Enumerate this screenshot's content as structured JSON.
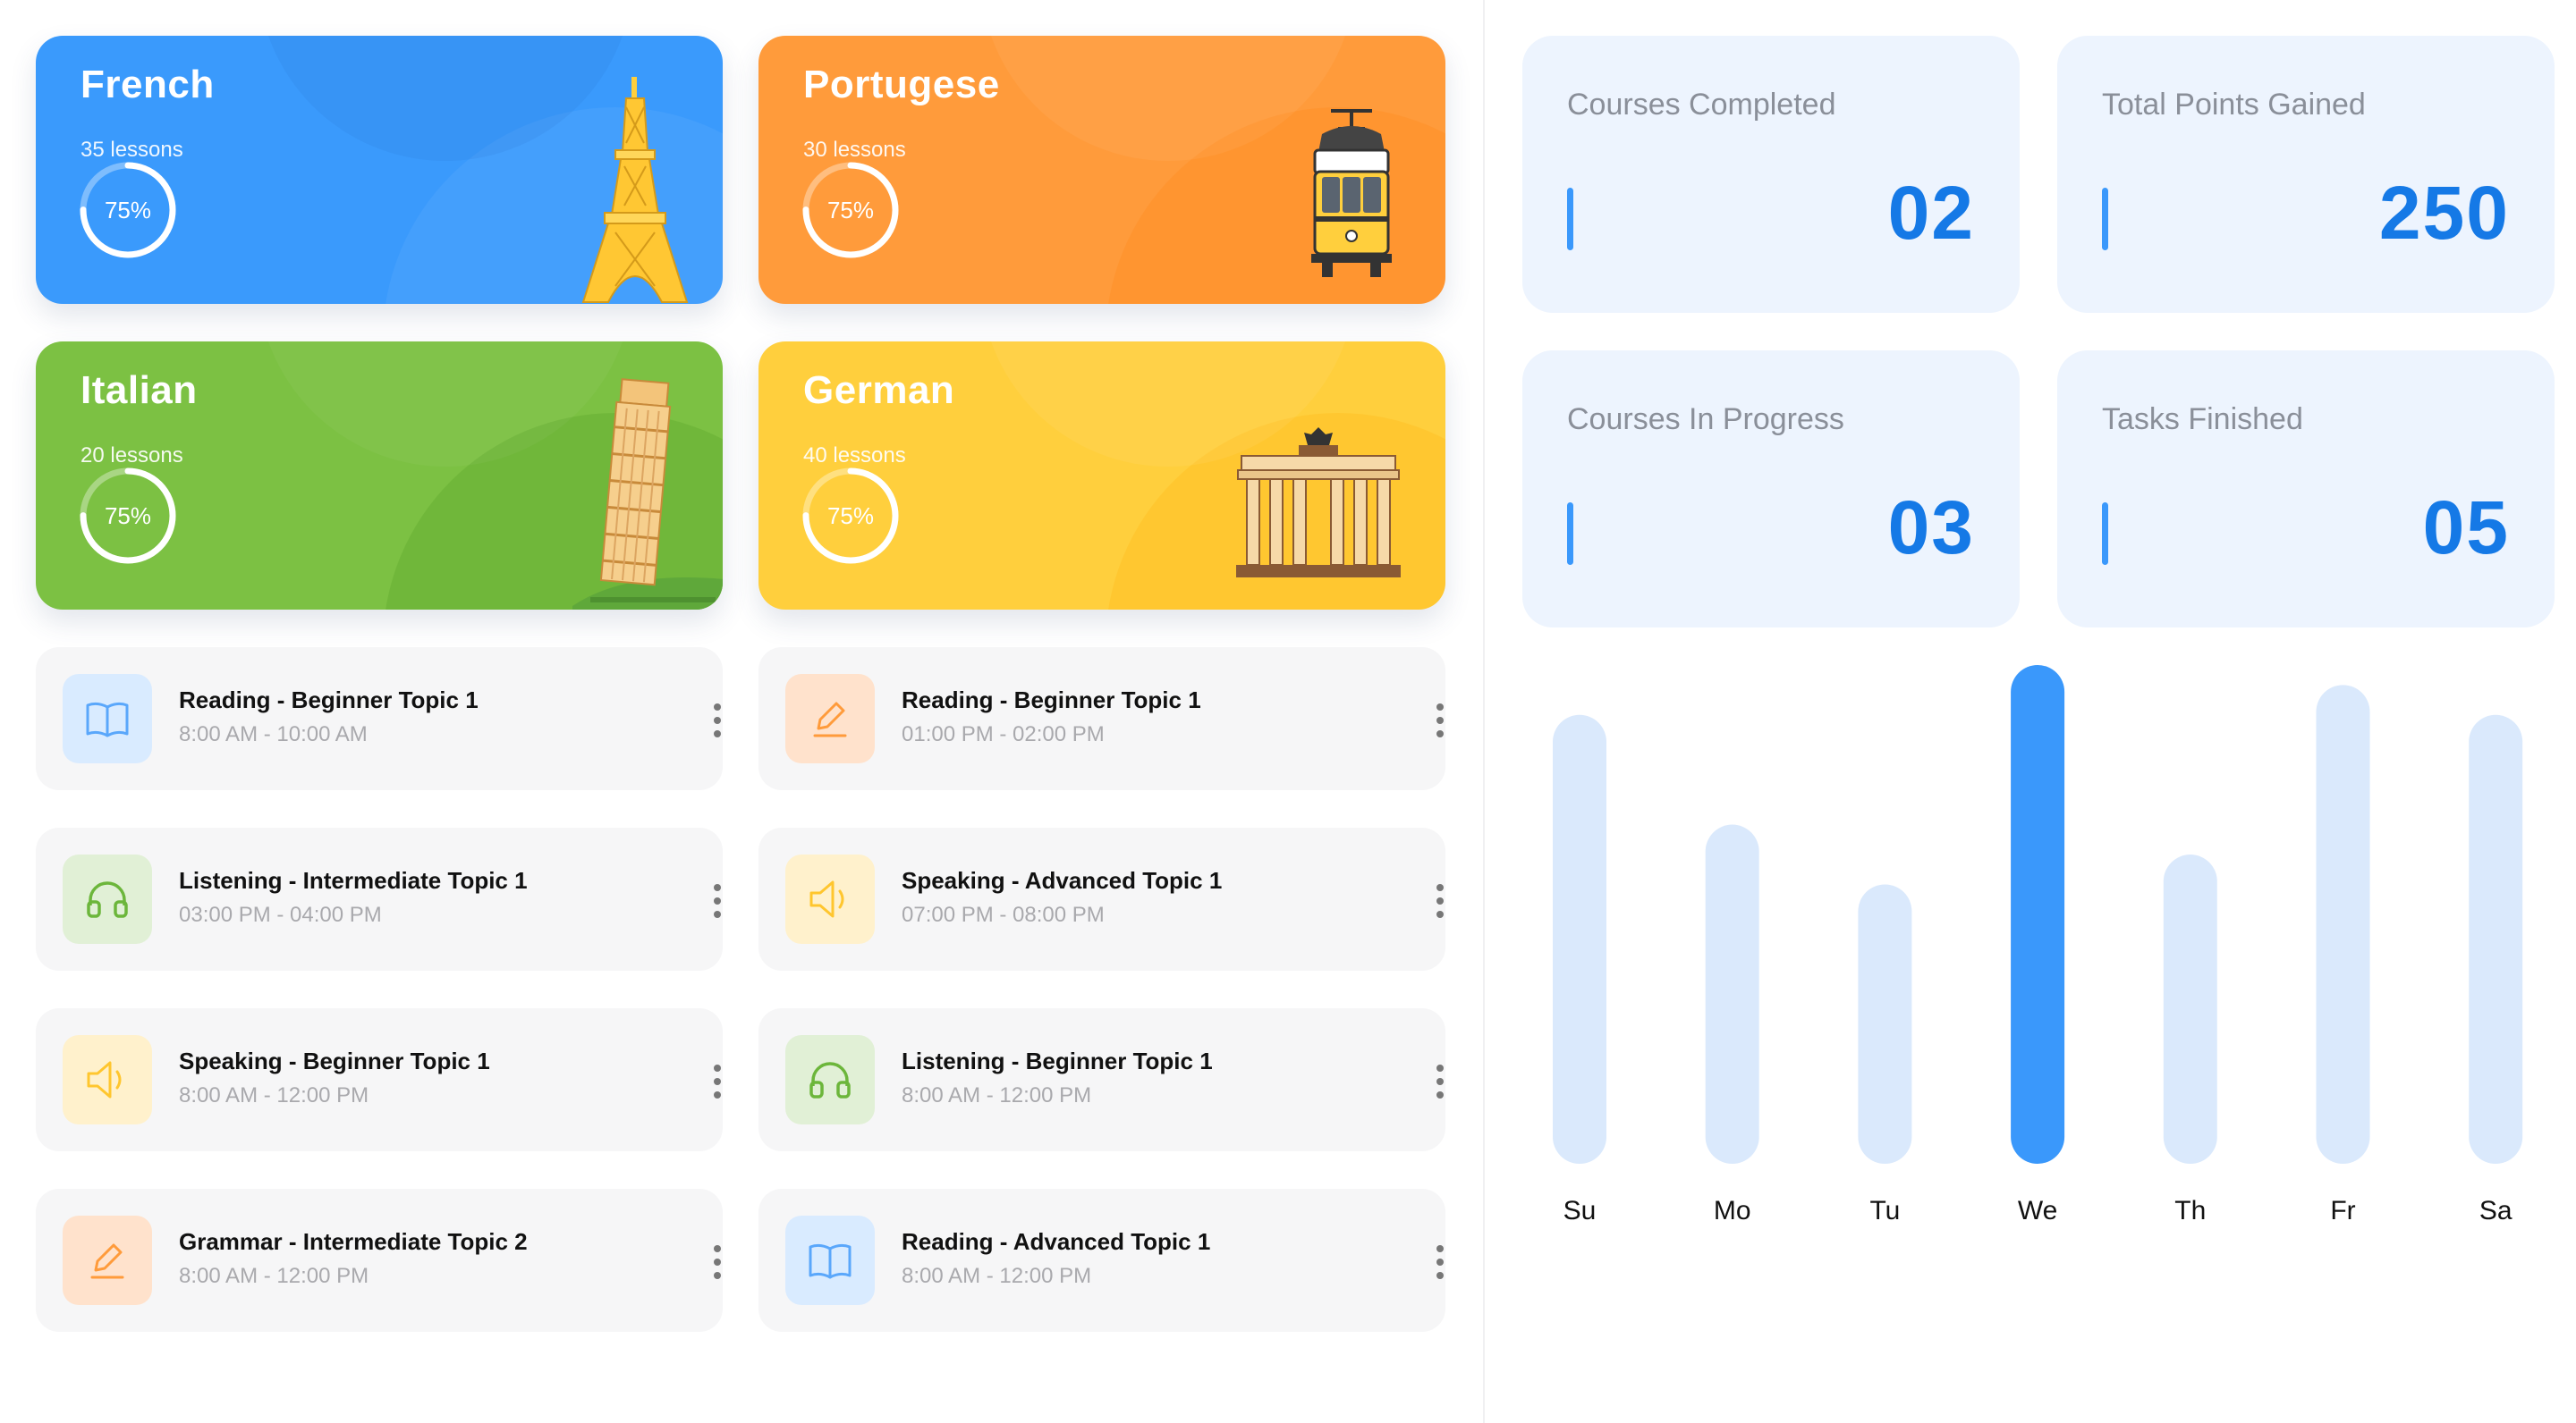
{
  "courses": [
    {
      "name": "French",
      "lessons": "35 lessons",
      "progress_label": "75%",
      "progress": 0.75,
      "color": "#3a9afc",
      "landmark": "eiffel-tower"
    },
    {
      "name": "Portugese",
      "lessons": "30 lessons",
      "progress_label": "75%",
      "progress": 0.75,
      "color": "#ff9b3b",
      "landmark": "tram"
    },
    {
      "name": "Italian",
      "lessons": "20 lessons",
      "progress_label": "75%",
      "progress": 0.75,
      "color": "#7cc143",
      "landmark": "leaning-tower"
    },
    {
      "name": "German",
      "lessons": "40 lessons",
      "progress_label": "75%",
      "progress": 0.75,
      "color": "#ffcf3d",
      "landmark": "brandenburg-gate"
    }
  ],
  "lessons": [
    {
      "title": "Reading - Beginner Topic 1",
      "time": "8:00 AM - 10:00 AM",
      "icon": "book-icon"
    },
    {
      "title": "Reading - Beginner Topic 1",
      "time": "01:00 PM - 02:00 PM",
      "icon": "pencil-icon"
    },
    {
      "title": "Listening - Intermediate Topic 1",
      "time": "03:00 PM - 04:00 PM",
      "icon": "headphones-icon"
    },
    {
      "title": "Speaking - Advanced Topic 1",
      "time": "07:00 PM - 08:00 PM",
      "icon": "speaker-icon"
    },
    {
      "title": "Speaking - Beginner Topic 1",
      "time": "8:00 AM - 12:00 PM",
      "icon": "speaker-icon"
    },
    {
      "title": "Listening - Beginner Topic 1",
      "time": "8:00 AM - 12:00 PM",
      "icon": "headphones-icon"
    },
    {
      "title": "Grammar - Intermediate Topic 2",
      "time": "8:00 AM - 12:00 PM",
      "icon": "pencil-icon"
    },
    {
      "title": "Reading - Advanced Topic 1",
      "time": "8:00 AM - 12:00 PM",
      "icon": "book-icon"
    }
  ],
  "stats": [
    {
      "label": "Courses Completed",
      "value": "02"
    },
    {
      "label": "Total Points Gained",
      "value": "250"
    },
    {
      "label": "Courses In Progress",
      "value": "03"
    },
    {
      "label": "Tasks Finished",
      "value": "05"
    }
  ],
  "colors": {
    "accent": "#3a98fb",
    "stat_value": "#1579e6",
    "bar_inactive": "#dae9fc",
    "bar_active": "#3a98fb"
  },
  "chart_data": {
    "type": "bar",
    "categories": [
      "Su",
      "Mo",
      "Tu",
      "We",
      "Th",
      "Fr",
      "Sa"
    ],
    "values": [
      0.9,
      0.68,
      0.56,
      1.0,
      0.62,
      0.96,
      0.9
    ],
    "highlighted": "We",
    "ylim": [
      0,
      1
    ],
    "grid": false,
    "title": "",
    "xlabel": "",
    "ylabel": ""
  }
}
